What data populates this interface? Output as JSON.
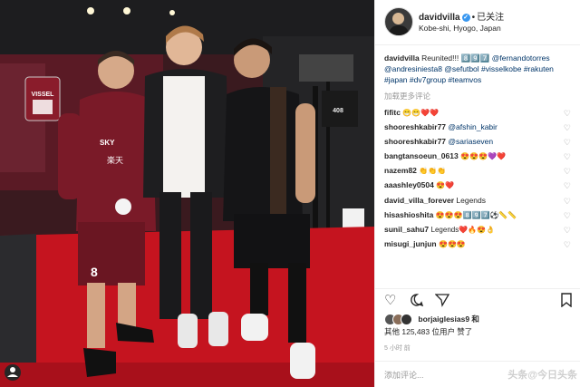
{
  "post": {
    "username": "davidvilla",
    "verified_mark": "✓",
    "dot": "•",
    "follow": "已关注",
    "location": "Kobe-shi, Hyogo, Japan",
    "caption_user": "davidvilla",
    "caption_text": "Reunited!!! 8️⃣9️⃣7️⃣",
    "caption_tags": "@fernandotorres @andresiniesta8 @sefutbol #visselkobe #rakuten #japan #dv7group #teamvos",
    "load_more": "加载更多评论"
  },
  "comments": [
    {
      "user": "fifitc",
      "text": "😁😁❤️❤️"
    },
    {
      "user": "shooreshkabir77",
      "text": "@afshin_kabir"
    },
    {
      "user": "shooreshkabir77",
      "text": "@sariaseven"
    },
    {
      "user": "bangtansoeun_0613",
      "text": "😍😍😍💜❤️"
    },
    {
      "user": "nazem82",
      "text": "👏👏👏"
    },
    {
      "user": "aaashley0504",
      "text": "😍❤️"
    },
    {
      "user": "david_villa_forever",
      "text": "Legends"
    },
    {
      "user": "hisashioshita",
      "text": "😍😍😍8️⃣9️⃣7️⃣⚽📏📏"
    },
    {
      "user": "sunil_sahu7",
      "text": "Legends❤️🔥😍👌"
    },
    {
      "user": "misugi_junjun",
      "text": "😍😍😍"
    }
  ],
  "actions": {
    "like_icon": "heart-outline",
    "comment_icon": "speech-bubble",
    "share_icon": "paper-plane",
    "save_icon": "bookmark"
  },
  "likes": {
    "liked_by": "borjaiglesias9 和",
    "others": "其他 125,483 位用户 赞了"
  },
  "time": "5 小时 前",
  "add_comment_placeholder": "添加评论...",
  "watermark": "头条@今日头条",
  "photo": {
    "banner_text": "VISSEL",
    "jersey_number": "8",
    "sponsor_1": "SKY",
    "sponsor_2": "楽天",
    "board_text": "408"
  },
  "colors": {
    "accent": "#3897f0",
    "link": "#003569",
    "text": "#262626",
    "muted": "#999999"
  }
}
